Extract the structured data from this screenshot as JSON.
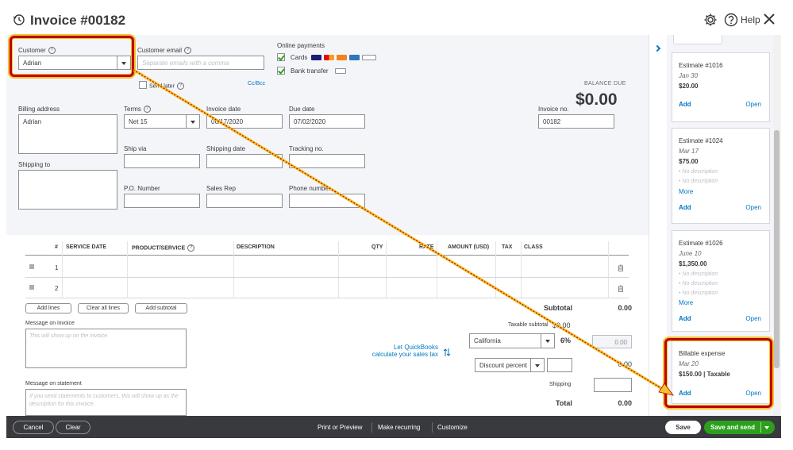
{
  "header": {
    "title": "Invoice #00182",
    "help_label": "Help"
  },
  "form": {
    "customer_label": "Customer",
    "customer_value": "Adrian",
    "customer_email_label": "Customer email",
    "customer_email_placeholder": "Separate emails with a comma",
    "send_later_label": "Send later",
    "cc_bcc_label": "Cc/Bcc",
    "online_payments_label": "Online payments",
    "cards_label": "Cards",
    "bank_transfer_label": "Bank transfer",
    "balance_due_label": "BALANCE DUE",
    "balance_due_value": "$0.00",
    "billing_address_label": "Billing address",
    "billing_address_value": "Adrian",
    "shipping_to_label": "Shipping to",
    "terms_label": "Terms",
    "terms_value": "Net 15",
    "invoice_date_label": "Invoice date",
    "invoice_date_value": "06/17/2020",
    "due_date_label": "Due date",
    "due_date_value": "07/02/2020",
    "invoice_no_label": "Invoice no.",
    "invoice_no_value": "00182",
    "ship_via_label": "Ship via",
    "shipping_date_label": "Shipping date",
    "tracking_no_label": "Tracking no.",
    "po_number_label": "P.O. Number",
    "sales_rep_label": "Sales Rep",
    "phone_number_label": "Phone number"
  },
  "table": {
    "headers": [
      "#",
      "SERVICE DATE",
      "PRODUCT/SERVICE",
      "DESCRIPTION",
      "QTY",
      "RATE",
      "AMOUNT (USD)",
      "TAX",
      "CLASS"
    ],
    "rows": [
      {
        "num": "1"
      },
      {
        "num": "2"
      }
    ],
    "add_lines_label": "Add lines",
    "clear_all_lines_label": "Clear all lines",
    "add_subtotal_label": "Add subtotal"
  },
  "message": {
    "invoice_label": "Message on invoice",
    "invoice_placeholder": "This will show up on the invoice.",
    "statement_label": "Message on statement",
    "statement_placeholder": "If you send statements to customers, this will show up as the description for this invoice."
  },
  "totals": {
    "subtotal_label": "Subtotal",
    "subtotal_value": "0.00",
    "taxable_subtotal_label": "Taxable subtotal",
    "taxable_subtotal_value": "$0.00",
    "tax_region": "California",
    "tax_rate": "6%",
    "tax_value": "0.00",
    "qb_link_line1": "Let QuickBooks",
    "qb_link_line2": "calculate your sales tax",
    "discount_select": "Discount percent",
    "discount_value": "0.00",
    "shipping_label": "Shipping",
    "total_label": "Total",
    "total_value": "0.00"
  },
  "sidebar": {
    "cards": [
      {
        "title": "Estimate #1016",
        "date": "Jan 30",
        "amount": "$20.00",
        "add": "Add",
        "open": "Open"
      },
      {
        "title": "Estimate #1024",
        "date": "Mar 17",
        "amount": "$75.00",
        "desc": [
          "No description",
          "No description"
        ],
        "more": "More",
        "add": "Add",
        "open": "Open"
      },
      {
        "title": "Estimate #1026",
        "date": "June 10",
        "amount": "$1,350.00",
        "desc": [
          "No description",
          "No description",
          "No description"
        ],
        "more": "More",
        "add": "Add",
        "open": "Open"
      },
      {
        "title": "Billable expense",
        "date": "Mar 20",
        "amount": "$150.00 | Taxable",
        "add": "Add",
        "open": "Open"
      }
    ]
  },
  "footer": {
    "cancel": "Cancel",
    "clear": "Clear",
    "print_preview": "Print or Preview",
    "make_recurring": "Make recurring",
    "customize": "Customize",
    "save": "Save",
    "save_and_send": "Save and send"
  },
  "colors": {
    "accent_green": "#2ca01c",
    "link_blue": "#0077c5",
    "annotation_red": "#c00000",
    "annotation_yellow": "#f2c230"
  }
}
